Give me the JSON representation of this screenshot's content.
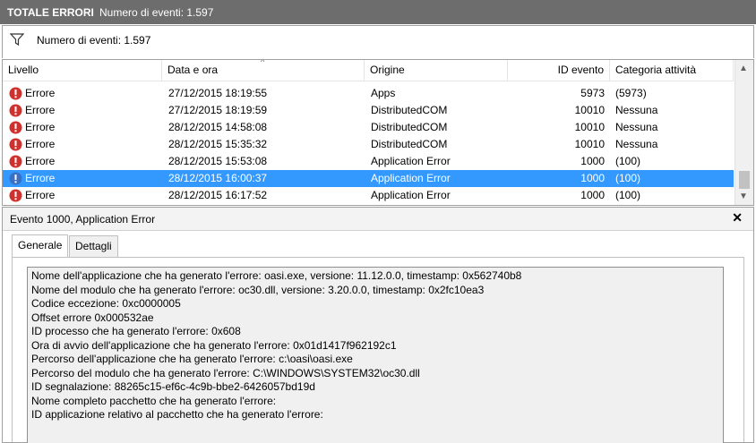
{
  "header": {
    "title": "TOTALE ERRORI",
    "count_text": "Numero di eventi: 1.597"
  },
  "filter": {
    "icon": "filter-icon",
    "text": "Numero di eventi: 1.597"
  },
  "columns": [
    "Livello",
    "Data e ora",
    "Origine",
    "ID evento",
    "Categoria attività"
  ],
  "rows": [
    {
      "level": "Errore",
      "date": "27/12/2015 18:19:55",
      "source": "Apps",
      "id": "5973",
      "cat": "(5973)"
    },
    {
      "level": "Errore",
      "date": "27/12/2015 18:19:59",
      "source": "DistributedCOM",
      "id": "10010",
      "cat": "Nessuna"
    },
    {
      "level": "Errore",
      "date": "28/12/2015 14:58:08",
      "source": "DistributedCOM",
      "id": "10010",
      "cat": "Nessuna"
    },
    {
      "level": "Errore",
      "date": "28/12/2015 15:35:32",
      "source": "DistributedCOM",
      "id": "10010",
      "cat": "Nessuna"
    },
    {
      "level": "Errore",
      "date": "28/12/2015 15:53:08",
      "source": "Application Error",
      "id": "1000",
      "cat": "(100)"
    },
    {
      "level": "Errore",
      "date": "28/12/2015 16:00:37",
      "source": "Application Error",
      "id": "1000",
      "cat": "(100)"
    },
    {
      "level": "Errore",
      "date": "28/12/2015 16:17:52",
      "source": "Application Error",
      "id": "1000",
      "cat": "(100)"
    }
  ],
  "colors": {
    "selection": "#3399ff",
    "error_icon": "#d0312d"
  },
  "detail": {
    "title": "Evento 1000, Application Error",
    "close_glyph": "✕",
    "tabs": [
      "Generale",
      "Dettagli"
    ],
    "lines": [
      "Nome dell'applicazione che ha generato l'errore: oasi.exe, versione: 11.12.0.0, timestamp: 0x562740b8",
      "Nome del modulo che ha generato l'errore: oc30.dll, versione: 3.20.0.0, timestamp: 0x2fc10ea3",
      "Codice eccezione: 0xc0000005",
      "Offset errore 0x000532ae",
      "ID processo che ha generato l'errore: 0x608",
      "Ora di avvio dell'applicazione che ha generato l'errore: 0x01d1417f962192c1",
      "Percorso dell'applicazione che ha generato l'errore: c:\\oasi\\oasi.exe",
      "Percorso del modulo che ha generato l'errore: C:\\WINDOWS\\SYSTEM32\\oc30.dll",
      "ID segnalazione: 88265c15-ef6c-4c9b-bbe2-6426057bd19d",
      "Nome completo pacchetto che ha generato l'errore:",
      "ID applicazione relativo al pacchetto che ha generato l'errore:"
    ]
  }
}
